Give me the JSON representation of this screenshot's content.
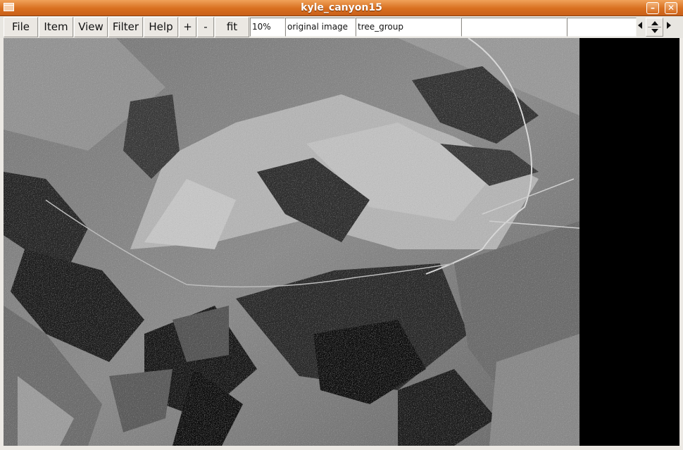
{
  "window": {
    "title": "kyle_canyon15",
    "minimize_glyph": "–",
    "close_glyph": "✕"
  },
  "toolbar": {
    "menus": [
      "File",
      "Item",
      "View",
      "Filter",
      "Help"
    ],
    "zoom_in": "+",
    "zoom_out": "-",
    "fit": "fit",
    "zoom_value": "10%",
    "layer": "original image",
    "group": "tree_group",
    "field_4": "",
    "field_5": ""
  },
  "viewer": {
    "image_subject": "grayscale aerial photo of a mountain canyon",
    "background": "#000000"
  }
}
